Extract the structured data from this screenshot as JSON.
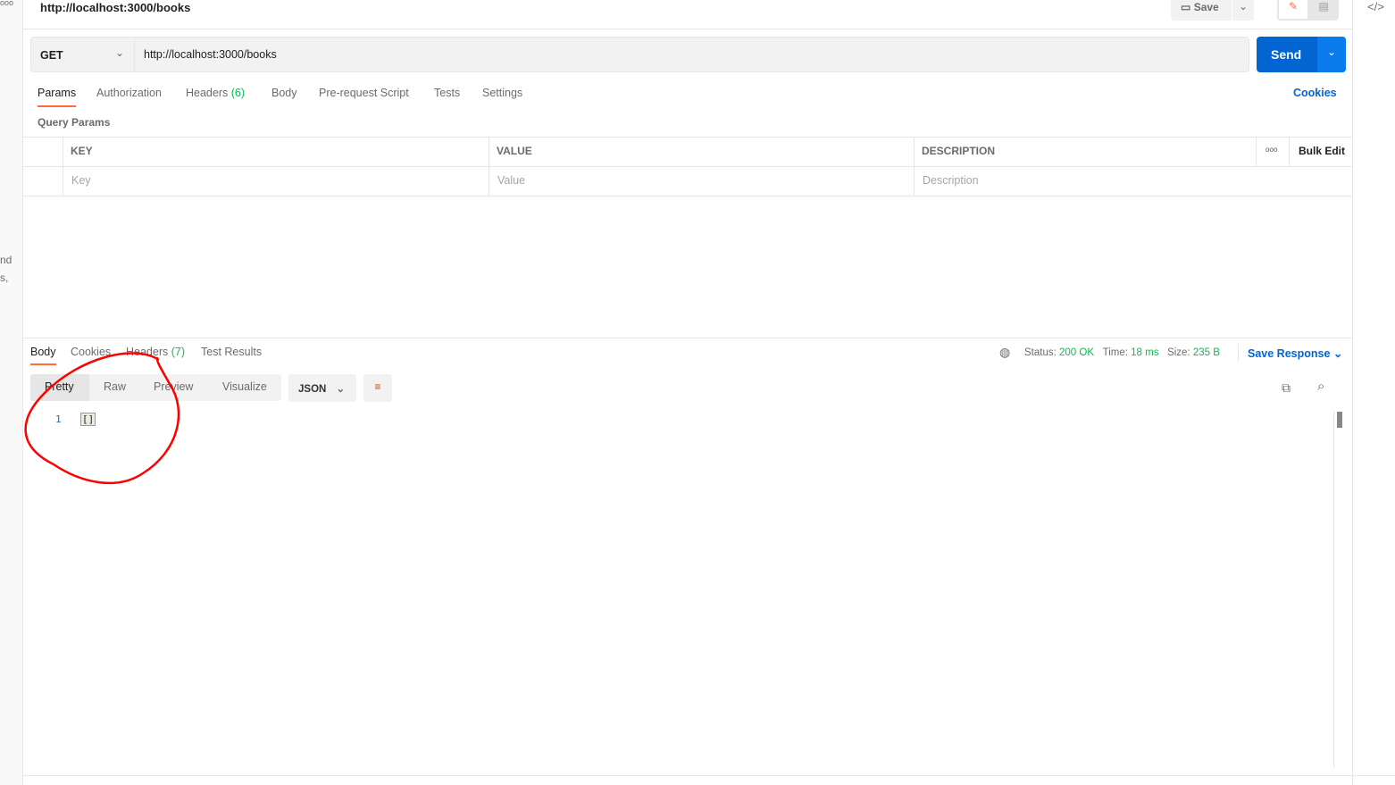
{
  "header": {
    "title": "http://localhost:3000/books",
    "save_label": "Save"
  },
  "left_fragments": [
    "nd",
    "s,"
  ],
  "request": {
    "method": "GET",
    "url": "http://localhost:3000/books",
    "send_label": "Send"
  },
  "request_tabs": [
    {
      "label": "Params"
    },
    {
      "label": "Authorization"
    },
    {
      "label": "Headers",
      "count": "(6)"
    },
    {
      "label": "Body"
    },
    {
      "label": "Pre-request Script"
    },
    {
      "label": "Tests"
    },
    {
      "label": "Settings"
    }
  ],
  "cookies_label": "Cookies",
  "params": {
    "title": "Query Params",
    "columns": [
      "KEY",
      "VALUE",
      "DESCRIPTION"
    ],
    "bulk_edit": "Bulk Edit",
    "placeholders": [
      "Key",
      "Value",
      "Description"
    ]
  },
  "response": {
    "tabs": [
      {
        "label": "Body"
      },
      {
        "label": "Cookies"
      },
      {
        "label": "Headers",
        "count": "(7)"
      },
      {
        "label": "Test Results"
      }
    ],
    "status_label": "Status:",
    "status": "200 OK",
    "time_label": "Time:",
    "time": "18 ms",
    "size_label": "Size:",
    "size": "235 B",
    "save_response": "Save Response",
    "view_modes": [
      "Pretty",
      "Raw",
      "Preview",
      "Visualize"
    ],
    "format": "JSON",
    "lines": [
      {
        "n": "1",
        "code": "[]"
      }
    ]
  },
  "colors": {
    "accent": "#ff6c37",
    "send": "#0265d2",
    "link": "#0265d2",
    "success": "#0cbb52",
    "annotation": "#ff0000"
  }
}
